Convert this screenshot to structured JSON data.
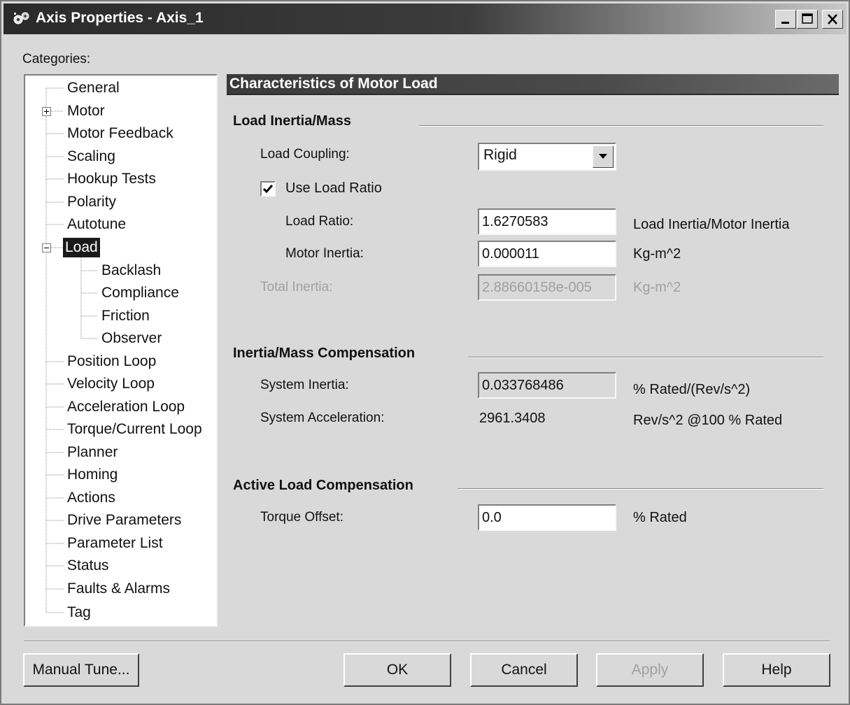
{
  "window": {
    "title": "Axis Properties - Axis_1"
  },
  "categories": {
    "label": "Categories:",
    "items": [
      {
        "label": "General"
      },
      {
        "label": "Motor"
      },
      {
        "label": "Motor Feedback"
      },
      {
        "label": "Scaling"
      },
      {
        "label": "Hookup Tests"
      },
      {
        "label": "Polarity"
      },
      {
        "label": "Autotune"
      },
      {
        "label": "Load"
      },
      {
        "label": "Backlash"
      },
      {
        "label": "Compliance"
      },
      {
        "label": "Friction"
      },
      {
        "label": "Observer"
      },
      {
        "label": "Position Loop"
      },
      {
        "label": "Velocity Loop"
      },
      {
        "label": "Acceleration Loop"
      },
      {
        "label": "Torque/Current Loop"
      },
      {
        "label": "Planner"
      },
      {
        "label": "Homing"
      },
      {
        "label": "Actions"
      },
      {
        "label": "Drive Parameters"
      },
      {
        "label": "Parameter List"
      },
      {
        "label": "Status"
      },
      {
        "label": "Faults & Alarms"
      },
      {
        "label": "Tag"
      }
    ]
  },
  "panel": {
    "header": "Characteristics of Motor Load",
    "load_inertia": {
      "title": "Load Inertia/Mass",
      "coupling_label": "Load Coupling:",
      "coupling_value": "Rigid",
      "use_load_ratio_label": "Use Load Ratio",
      "use_load_ratio_checked": true,
      "load_ratio_label": "Load Ratio:",
      "load_ratio_value": "1.6270583",
      "load_ratio_unit": "Load Inertia/Motor Inertia",
      "motor_inertia_label": "Motor Inertia:",
      "motor_inertia_value": "0.000011",
      "motor_inertia_unit": "Kg-m^2",
      "total_inertia_label": "Total Inertia:",
      "total_inertia_value": "2.88660158e-005",
      "total_inertia_unit": "Kg-m^2"
    },
    "compensation": {
      "title": "Inertia/Mass Compensation",
      "system_inertia_label": "System Inertia:",
      "system_inertia_value": "0.033768486",
      "system_inertia_unit": "% Rated/(Rev/s^2)",
      "system_accel_label": "System Acceleration:",
      "system_accel_value": "2961.3408",
      "system_accel_unit": "Rev/s^2 @100 % Rated"
    },
    "active_load": {
      "title": "Active Load Compensation",
      "torque_offset_label": "Torque Offset:",
      "torque_offset_value": "0.0",
      "torque_offset_unit": "% Rated"
    }
  },
  "buttons": {
    "manual_tune": "Manual Tune...",
    "ok": "OK",
    "cancel": "Cancel",
    "apply": "Apply",
    "help": "Help"
  }
}
